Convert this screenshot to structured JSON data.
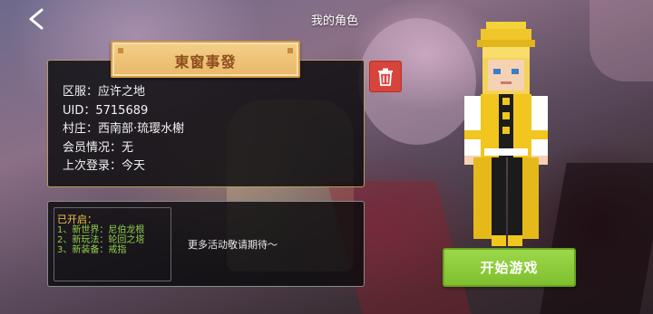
{
  "header": {
    "title": "我的角色"
  },
  "character": {
    "name": "東窗事發",
    "info_lines": [
      "区服：应许之地",
      "UID：5715689",
      "村庄：西南部·琉璎水榭",
      "会员情况：无",
      "上次登录：今天"
    ]
  },
  "unlocked": {
    "title": "已开启：",
    "items": [
      "1、新世界：尼伯龙根",
      "2、新玩法：轮回之塔",
      "3、新装备：戒指"
    ],
    "more_text": "更多活动敬请期待～"
  },
  "actions": {
    "start_label": "开始游戏"
  },
  "icons": {
    "back": "chevron-left-icon",
    "delete": "trash-icon"
  },
  "colors": {
    "banner": "#f4cf88",
    "start_button": "#8cca3a",
    "delete_button": "#d6443b",
    "unlocked_title": "#f0c44a",
    "unlocked_items": "#8fd24a"
  }
}
